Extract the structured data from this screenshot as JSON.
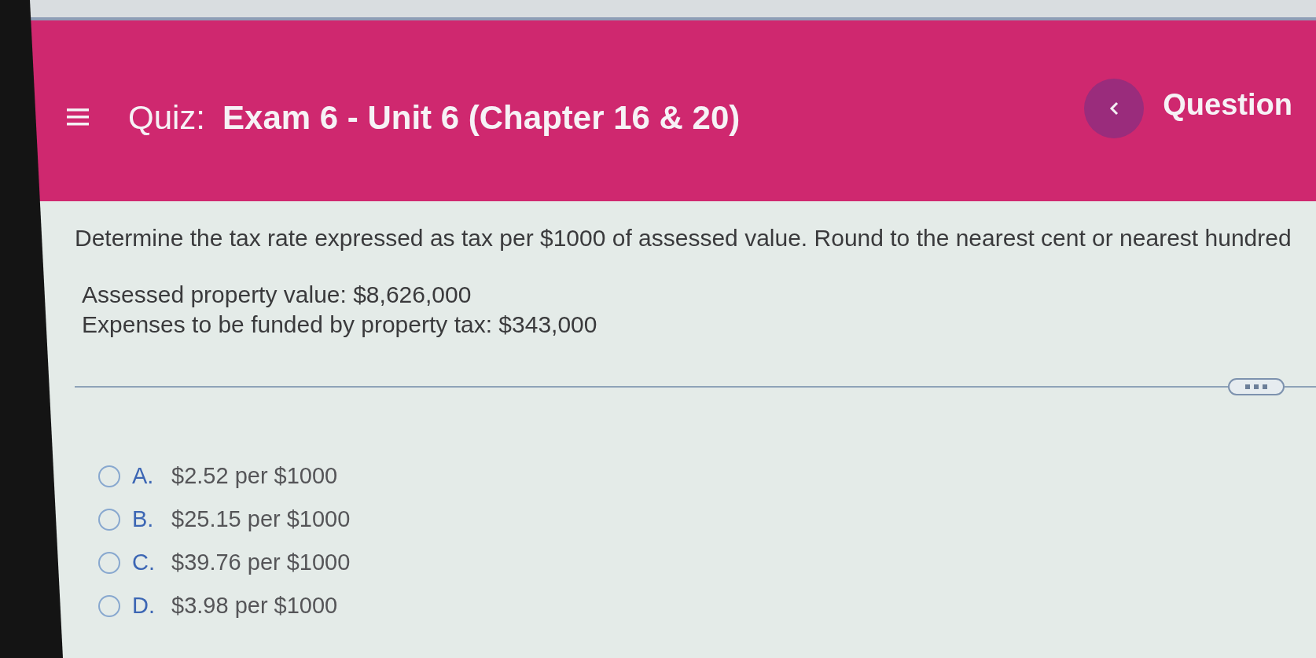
{
  "header": {
    "title_prefix": "Quiz:",
    "title": "Exam 6 - Unit 6 (Chapter 16 & 20)",
    "question_label": "Question"
  },
  "question": {
    "prompt": "Determine the tax rate expressed as tax per $1000 of assessed value. Round to the nearest cent or nearest hundred",
    "details": [
      "Assessed property value: $8,626,000",
      "Expenses to be funded by property tax: $343,000"
    ]
  },
  "choices": [
    {
      "letter": "A.",
      "text": "$2.52 per $1000",
      "selected": false
    },
    {
      "letter": "B.",
      "text": "$25.15 per $1000",
      "selected": false
    },
    {
      "letter": "C.",
      "text": "$39.76 per $1000",
      "selected": false
    },
    {
      "letter": "D.",
      "text": "$3.98 per $1000",
      "selected": false
    }
  ]
}
